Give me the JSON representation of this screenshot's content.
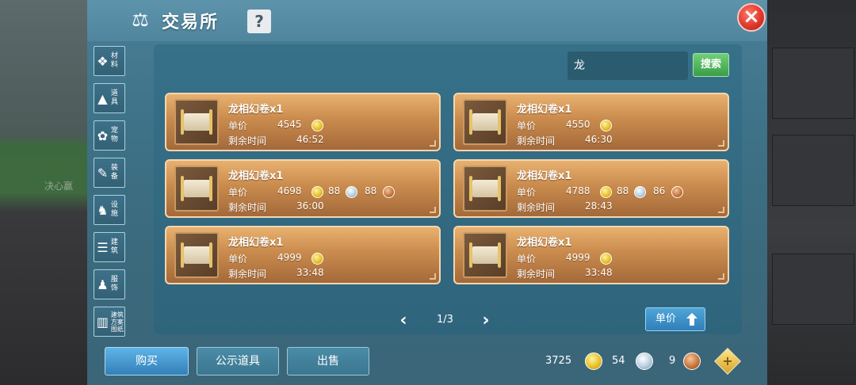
{
  "window": {
    "title": "交易所",
    "help_label": "?",
    "close_label": "×",
    "scale_icon": "scale-icon",
    "background_text": "决心赢"
  },
  "sidebar": {
    "items": [
      {
        "label": "材料",
        "icon": "materials-icon",
        "glyph": "❖"
      },
      {
        "label": "道具",
        "icon": "props-icon",
        "glyph": "▲"
      },
      {
        "label": "宠物",
        "icon": "paw-icon",
        "glyph": "✿"
      },
      {
        "label": "装备",
        "icon": "equipment-icon",
        "glyph": "✎"
      },
      {
        "label": "设施",
        "icon": "facility-icon",
        "glyph": "♞"
      },
      {
        "label": "建筑",
        "icon": "building-icon",
        "glyph": "☰"
      },
      {
        "label": "服饰",
        "icon": "clothing-icon",
        "glyph": "♟"
      },
      {
        "label": "建筑方案图纸",
        "icon": "blueprint-icon",
        "glyph": "▥"
      }
    ]
  },
  "search": {
    "value": "龙",
    "button_label": "搜索"
  },
  "listing": {
    "price_label": "单价",
    "time_label": "剩余时间",
    "items": [
      {
        "name": "龙相幻卷x1",
        "gold": "4545",
        "silver": "",
        "bronze": "",
        "time": "46:52"
      },
      {
        "name": "龙相幻卷x1",
        "gold": "4550",
        "silver": "",
        "bronze": "",
        "time": "46:30"
      },
      {
        "name": "龙相幻卷x1",
        "gold": "4698",
        "silver": "88",
        "bronze": "88",
        "time": "36:00"
      },
      {
        "name": "龙相幻卷x1",
        "gold": "4788",
        "silver": "88",
        "bronze": "86",
        "time": "28:43"
      },
      {
        "name": "龙相幻卷x1",
        "gold": "4999",
        "silver": "",
        "bronze": "",
        "time": "33:48"
      },
      {
        "name": "龙相幻卷x1",
        "gold": "4999",
        "silver": "",
        "bronze": "",
        "time": "33:48"
      }
    ]
  },
  "pagination": {
    "prev": "‹",
    "next": "›",
    "text": "1/3"
  },
  "sort": {
    "label": "单价"
  },
  "bottom": {
    "buy_label": "购买",
    "show_label": "公示道具",
    "sell_label": "出售"
  },
  "currency": {
    "gold": "3725",
    "silver": "54",
    "bronze": "9",
    "add_label": "+"
  },
  "colors": {
    "card_top": "#e8b170",
    "card_bottom": "#a4693a",
    "panel": "#367089",
    "search_button": "#3b9d47",
    "buy_button": "#347fb9",
    "close_button": "#e0392e"
  }
}
